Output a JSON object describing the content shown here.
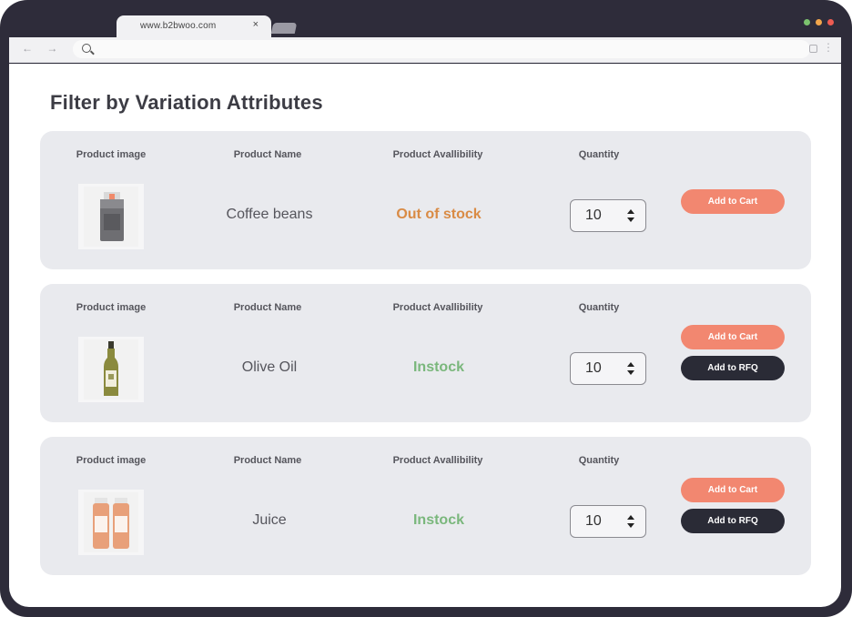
{
  "browser": {
    "tab_url": "www.b2bwoo.com",
    "tab_close": "×",
    "nav": "← →",
    "more": "⋮"
  },
  "page": {
    "title": "Filter by Variation Attributes"
  },
  "columns": {
    "image": "Product image",
    "name": "Product Name",
    "availability": "Product Avallibility",
    "quantity": "Quantity"
  },
  "products": [
    {
      "name": "Coffee beans",
      "availability": "Out of stock",
      "availability_color": "#d98b45",
      "quantity": "10",
      "add_to_cart": "Add to Cart",
      "add_to_rfq": "",
      "image_icon": "coffee-bag-icon"
    },
    {
      "name": "Olive Oil",
      "availability": "Instock",
      "availability_color": "#7ab77c",
      "quantity": "10",
      "add_to_cart": "Add to Cart",
      "add_to_rfq": "Add to RFQ",
      "image_icon": "olive-oil-bottle-icon"
    },
    {
      "name": "Juice",
      "availability": "Instock",
      "availability_color": "#7ab77c",
      "quantity": "10",
      "add_to_cart": "Add to Cart",
      "add_to_rfq": "Add to RFQ",
      "image_icon": "juice-bottles-icon"
    }
  ],
  "colors": {
    "accent": "#f28770",
    "dark_button": "#2a2b36",
    "frame": "#2e2c3a",
    "window_dots": [
      "#7cc36e",
      "#f2a64b",
      "#ee5c52"
    ]
  }
}
